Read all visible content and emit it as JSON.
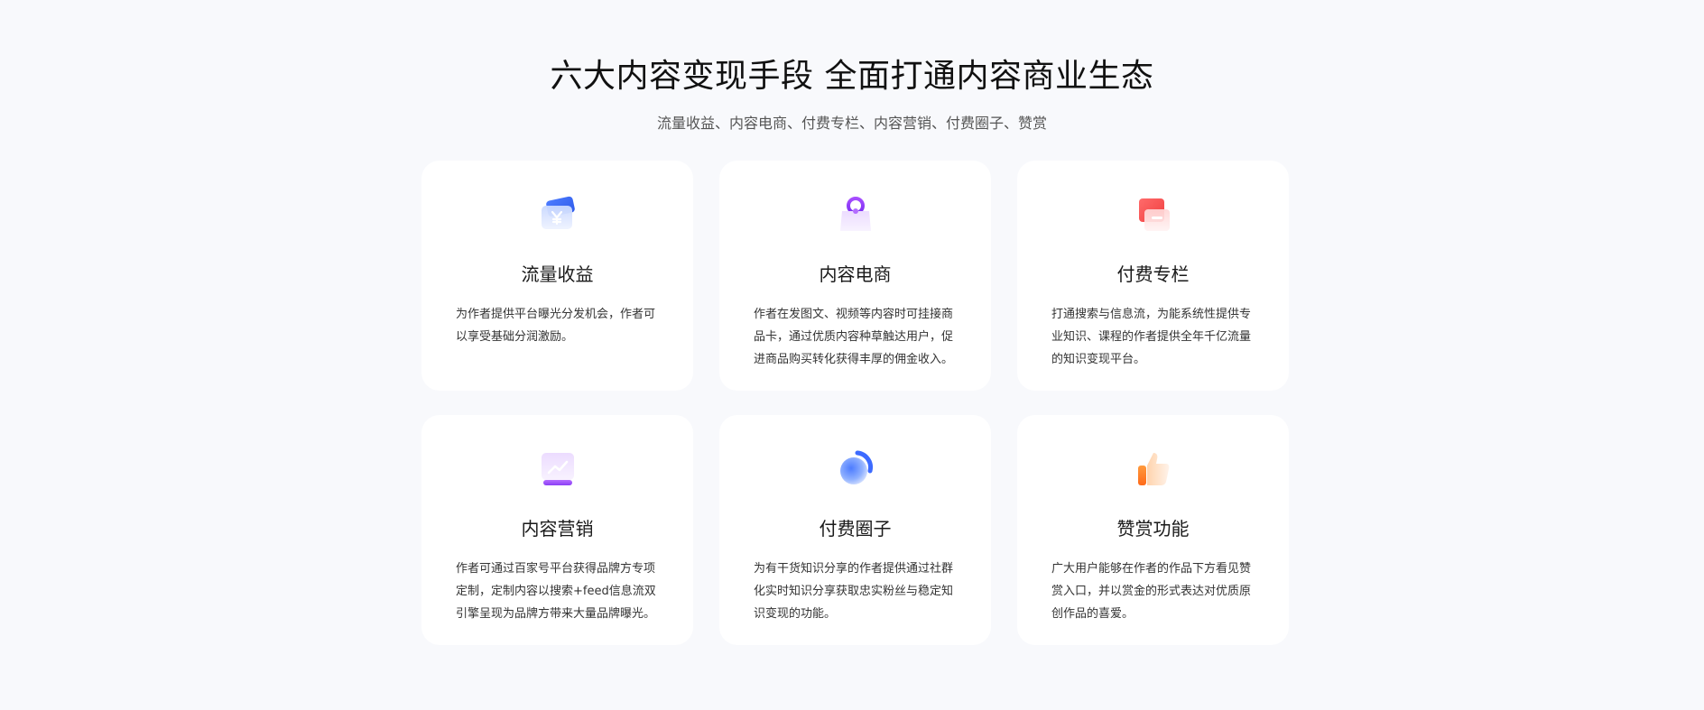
{
  "header": {
    "title": "六大内容变现手段 全面打通内容商业生态",
    "subtitle": "流量收益、内容电商、付费专栏、内容营销、付费圈子、赞赏"
  },
  "cards": [
    {
      "icon": "yuan-card-icon",
      "title": "流量收益",
      "desc": "为作者提供平台曝光分发机会，作者可以享受基础分润激励。"
    },
    {
      "icon": "shopping-bag-icon",
      "title": "内容电商",
      "desc": "作者在发图文、视频等内容时可挂接商品卡，通过优质内容种草触达用户，促进商品购买转化获得丰厚的佣金收入。"
    },
    {
      "icon": "wallet-icon",
      "title": "付费专栏",
      "desc": "打通搜索与信息流，为能系统性提供专业知识、课程的作者提供全年千亿流量的知识变现平台。"
    },
    {
      "icon": "trend-chart-icon",
      "title": "内容营销",
      "desc": "作者可通过百家号平台获得品牌方专项定制，定制内容以搜索+feed信息流双引擎呈现为品牌方带来大量品牌曝光。"
    },
    {
      "icon": "circle-group-icon",
      "title": "付费圈子",
      "desc": "为有干货知识分享的作者提供通过社群化实时知识分享获取忠实粉丝与稳定知识变现的功能。"
    },
    {
      "icon": "thumbs-up-icon",
      "title": "赞赏功能",
      "desc": "广大用户能够在作者的作品下方看见赞赏入口，并以赏金的形式表达对优质原创作品的喜爱。"
    }
  ]
}
